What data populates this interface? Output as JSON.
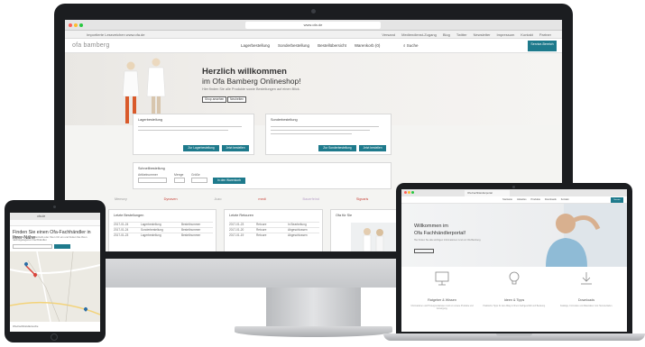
{
  "imac": {
    "url": "www.ofa.de",
    "bookmark_left": "Importierte Lesezeichen  www.ofa.de",
    "bookmarks": [
      "Versand",
      "Mediendienst-Zugang",
      "Blog",
      "Twitter",
      "Newsletter",
      "Impressum",
      "Kontakt",
      "Partner"
    ],
    "logo": "ofa bamberg",
    "nav": [
      "Lagerbestellung",
      "Sonderbestellung",
      "Bestellübersicht",
      "Warenkorb (0)"
    ],
    "search_label": "Suche",
    "service_button": "Service-Bereich",
    "hero": {
      "title": "Herzlich willkommen",
      "subtitle": "im Ofa Bamberg Onlineshop!",
      "text": "Hier finden Sie alle Produkte sowie Bestellungen auf einen Blick.",
      "button_1": "Shop ansehen",
      "button_2": "Neuheiten"
    },
    "panel_left": {
      "title": "Lagerbestellung",
      "button_1": "Zur Lagerbestellung",
      "button_2": "Jetzt bestellen"
    },
    "panel_right": {
      "title": "Sonderbestellung",
      "button_1": "Zur Sonderbestellung",
      "button_2": "Jetzt bestellen"
    },
    "quick_order": {
      "title": "Schnellbestellung",
      "field_1": "Artikelnummer",
      "field_2": "Menge",
      "field_3": "Größe",
      "button": "In den Warenkorb"
    },
    "brands": [
      "Memory",
      "Dynaven",
      "Juzo",
      "medi",
      "Bauerfeind",
      "Sigvaris",
      "Thuasne",
      "Lohmann",
      "ofa"
    ],
    "box_orders": {
      "title": "Letzte Bestellungen",
      "rows": [
        [
          "2017-01-24",
          "Lagerbestellung",
          "Bestellnummer"
        ],
        [
          "2017-01-24",
          "Sonderbestellung",
          "Bestellnummer"
        ],
        [
          "2017-01-23",
          "Lagerbestellung",
          "Bestellnummer"
        ]
      ]
    },
    "box_returns": {
      "title": "Letzte Retouren",
      "rows": [
        [
          "2017-01-23",
          "Retoure",
          "In Bearbeitung"
        ],
        [
          "2017-01-20",
          "Retoure",
          "Abgeschlossen"
        ],
        [
          "2017-01-19",
          "Retoure",
          "Abgeschlossen"
        ]
      ]
    },
    "box_news": {
      "title": "Ofa für Sie"
    }
  },
  "tablet": {
    "url": "ofa.de",
    "title": "Finden Sie einen Ofa-Fachhändler in Ihrer Nähe",
    "text": "Geben Sie Ihre Postleitzahl oder Ihren Ort ein und finden Sie Ihren nächstgelegenen Fachhändler.",
    "footer": "Ofa-Fachhändlersuche"
  },
  "laptop": {
    "tab": "Ofa Fachhändlerportal",
    "nav": [
      "Startseite",
      "Aktuelles",
      "Produkte",
      "Downloads",
      "Kontakt"
    ],
    "service_button": "Service",
    "hero_title": "Willkommen im",
    "hero_subtitle": "Ofa Fachhändlerportal!",
    "hero_text": "Hier finden Sie alle wichtigen Informationen rund um Ofa Bamberg.",
    "features": [
      {
        "title": "Ratgeber & Wissen",
        "text": "Informationen und Hintergrundwissen rund um unsere Produkte und Versorgung."
      },
      {
        "title": "Ideen & Tipps",
        "text": "Praktische Tipps für den Alltag in Ihrem Fachgeschäft und Beratung."
      },
      {
        "title": "Downloads",
        "text": "Kataloge, Formulare und Materialien zum Herunterladen."
      }
    ]
  },
  "colors": {
    "accent": "#1e7a8c",
    "device_dark": "#1b1d20",
    "device_silver": "#c5c7ca"
  }
}
